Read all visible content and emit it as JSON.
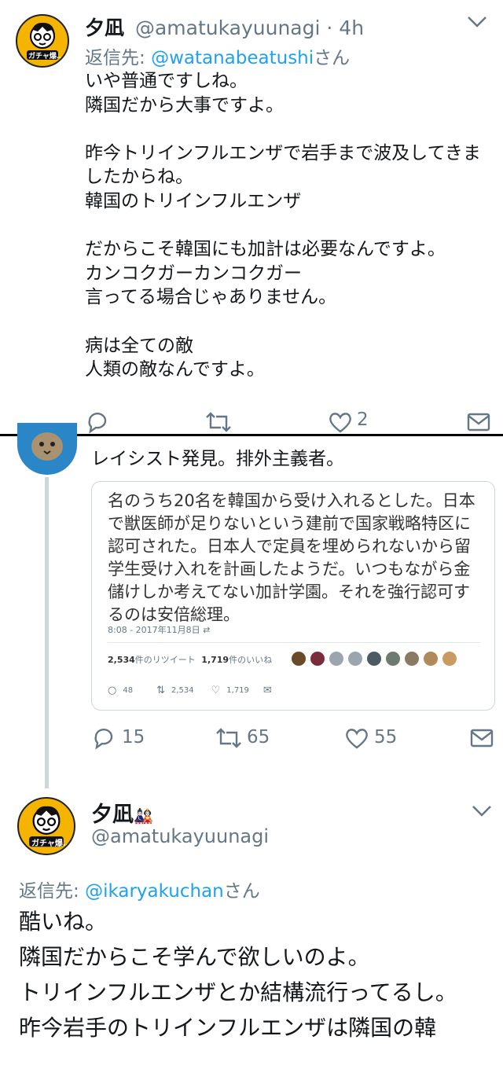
{
  "tweet1": {
    "name": "夕凪",
    "handle": "@amatukayuunagi",
    "separator": "·",
    "time": "4h",
    "reply_prefix": "返信先: ",
    "reply_handle": "@watanabeatushi",
    "reply_suffix": "さん",
    "body": "いや普通ですしね。\n隣国だから大事ですよ。\n\n昨今トリインフルエンザで岩手まで波及してきましたからね。\n韓国のトリインフルエンザ\n\nだからこそ韓国にも加計は必要なんですよ。\nカンコクガーカンコクガー\n言ってる場合じゃありません。\n\n病は全ての敵\n人類の敵なんですよ。",
    "likes": "2",
    "avatar_label": "ガチャ爆…"
  },
  "tweet2": {
    "body": "レイシスト発見。排外主義者。",
    "quote": {
      "text": "名のうち20名を韓国から受け入れるとした。日本で獣医師が足りないという建前で国家戦略特区に認可された。日本人で定員を埋められないから留学生受け入れを計画したようだ。いつもながら金儲けしか考えてない加計学園。それを強行認可するのは安倍総理。",
      "timestamp": "8:08 - 2017年11月8日",
      "retweets_num": "2,534",
      "retweets_label": "件のリツイート",
      "likes_num": "1,719",
      "likes_label": "件のいいね",
      "reply_count": "48",
      "retweet_count": "2,534",
      "like_count": "1,719"
    },
    "replies": "15",
    "retweets": "65",
    "likes": "55"
  },
  "tweet3": {
    "name": "夕凪",
    "name_badge": "🎎",
    "handle": "@amatukayuunagi",
    "avatar_label": "ガチャ爆…",
    "reply_prefix": "返信先: ",
    "reply_handle": "@ikaryakuchan",
    "reply_suffix": "さん",
    "body": "酷いね。\n隣国だからこそ学んで欲しいのよ。\nトリインフルエンザとか結構流行ってるし。\n昨今岩手のトリインフルエンザは隣国の韓"
  },
  "colors": {
    "accent": "#1da1f2",
    "muted": "#657786",
    "divider": "#000000"
  }
}
